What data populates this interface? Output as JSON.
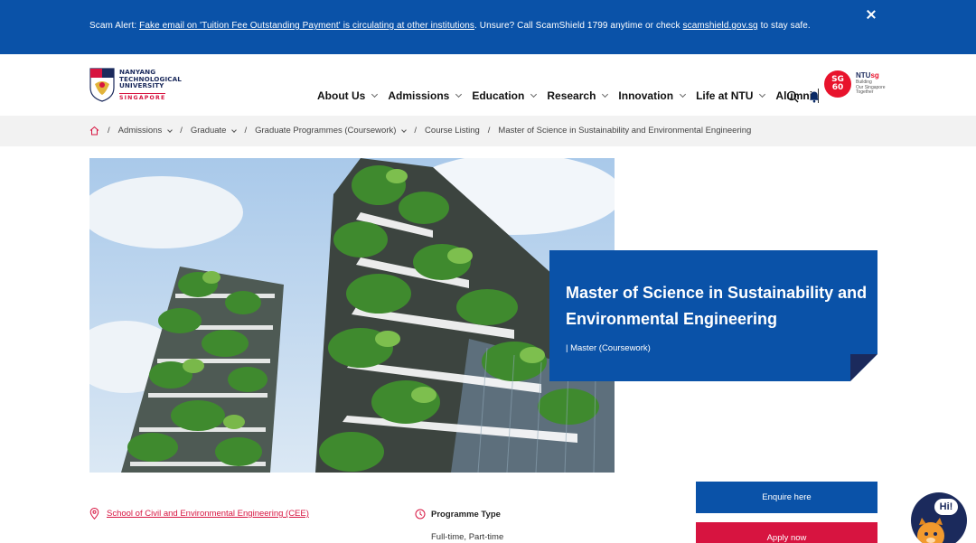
{
  "alert": {
    "prefix": "Scam Alert: ",
    "link_text": "Fake email on 'Tuition Fee Outstanding Payment' is circulating at other institutions",
    "middle": ". Unsure? Call ScamShield 1799 anytime or check ",
    "site_link": "scamshield.gov.sg",
    "suffix": " to stay safe."
  },
  "logo": {
    "line1": "NANYANG",
    "line2": "TECHNOLOGICAL",
    "line3": "UNIVERSITY",
    "line4": "SINGAPORE"
  },
  "nav": {
    "items": [
      "About Us",
      "Admissions",
      "Education",
      "Research",
      "Innovation",
      "Life at NTU"
    ],
    "alumni": "Alumni"
  },
  "sg60": {
    "badge_line1": "SG",
    "badge_line2": "60",
    "title_a": "NTU",
    "title_b": "sg",
    "sub1": "Building",
    "sub2": "Our Singapore",
    "sub3": "Together"
  },
  "breadcrumb": {
    "items": [
      "Admissions",
      "Graduate",
      "Graduate Programmes (Coursework)",
      "Course Listing"
    ],
    "current": "Master of Science in Sustainability and Environmental Engineering",
    "separator": "/"
  },
  "hero": {
    "title": "Master of Science in Sustainability and Environmental Engineering",
    "subtitle": "| Master (Coursework)"
  },
  "info": {
    "school": "School of Civil and Environmental Engineering (CEE)",
    "programme_type_label": "Programme Type",
    "programme_type_value": "Full-time, Part-time"
  },
  "buttons": {
    "enquire": "Enquire here",
    "apply": "Apply now"
  },
  "chatbot": {
    "greeting": "Hi!"
  },
  "colors": {
    "primary_blue": "#0a52a8",
    "accent_red": "#d71440",
    "navy": "#1b2a5c"
  }
}
